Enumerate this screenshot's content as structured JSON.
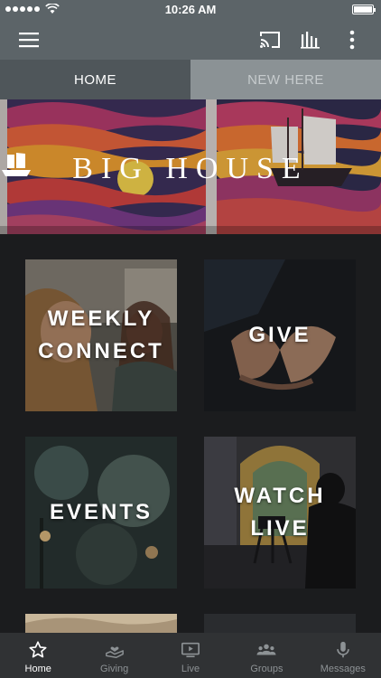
{
  "status_bar": {
    "time": "10:26 AM"
  },
  "header": {
    "icons": [
      "menu-icon",
      "cast-icon",
      "bars-icon",
      "more-vertical-icon"
    ]
  },
  "tabs": [
    {
      "label": "HOME",
      "active": true
    },
    {
      "label": "NEW HERE",
      "active": false
    }
  ],
  "banner": {
    "title_left": "BIG",
    "title_right": "HOUSE"
  },
  "tiles": [
    {
      "label": "WEEKLY\nCONNECT"
    },
    {
      "label": "GIVE"
    },
    {
      "label": "EVENTS"
    },
    {
      "label": "WATCH\nLIVE"
    }
  ],
  "bottom_nav": [
    {
      "label": "Home",
      "icon": "star-icon",
      "active": true
    },
    {
      "label": "Giving",
      "icon": "giving-hand-icon",
      "active": false
    },
    {
      "label": "Live",
      "icon": "tv-play-icon",
      "active": false
    },
    {
      "label": "Groups",
      "icon": "groups-icon",
      "active": false
    },
    {
      "label": "Messages",
      "icon": "microphone-icon",
      "active": false
    }
  ],
  "colors": {
    "header_bg": "#5c6468",
    "tab_active_bg": "#4f565a",
    "tab_inactive_bg": "#8b9295",
    "content_bg": "#1b1c1e",
    "nav_bg": "#303234"
  }
}
